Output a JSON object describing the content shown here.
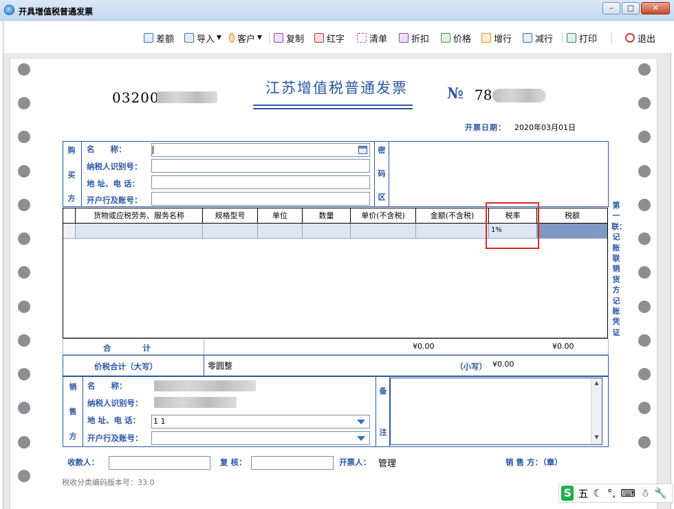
{
  "window": {
    "title": "开具增值税普通发票",
    "controls": [
      "–",
      "□",
      "✕"
    ]
  },
  "toolbar": {
    "items": [
      {
        "name": "quota",
        "label": "差额",
        "icon": "list-icon",
        "color": "#3a6fb0"
      },
      {
        "name": "import",
        "label": "导入",
        "icon": "import-icon",
        "color": "#3a6fb0",
        "caret": "▼"
      },
      {
        "name": "customer",
        "label": "客户",
        "icon": "customer-icon",
        "color": "#d08a1e",
        "caret": "▼"
      },
      {
        "name": "copy",
        "label": "复制",
        "icon": "copy-icon",
        "color": "#8a4aa8"
      },
      {
        "name": "red",
        "label": "红字",
        "icon": "red-invoice-icon",
        "color": "#c33333"
      },
      {
        "name": "list",
        "label": "清单",
        "icon": "bullet-list-icon",
        "color": "#c33399"
      },
      {
        "name": "discount",
        "label": "折扣",
        "icon": "discount-icon",
        "color": "#8a4aa8"
      },
      {
        "name": "price",
        "label": "价格",
        "icon": "price-icon",
        "color": "#3c9a3c"
      },
      {
        "name": "add-row",
        "label": "增行",
        "icon": "add-row-icon",
        "color": "#d08a1e"
      },
      {
        "name": "del-row",
        "label": "减行",
        "icon": "delete-row-icon",
        "color": "#3a6fb0"
      },
      {
        "name": "print",
        "label": "打印",
        "icon": "printer-icon",
        "color": "#2e8b57"
      },
      {
        "name": "exit",
        "label": "退出",
        "icon": "power-icon",
        "color": "#d23b3b"
      }
    ]
  },
  "invoice": {
    "code_prefix": "03200",
    "title": "江苏增值税普通发票",
    "number_mark": "№",
    "number_prefix": "78",
    "date_label": "开票日期：",
    "date": "2020年03月01日"
  },
  "buyer": {
    "section": [
      "购",
      "买",
      "方"
    ],
    "name_label": "名　　称：",
    "tax_id_label": "纳税人识别号：",
    "address_label": "地 址、电 话：",
    "bank_label": "开户行及账号：",
    "name": "",
    "tax_id": "",
    "address": "",
    "bank": ""
  },
  "cipher": {
    "section": [
      "密",
      "码",
      "区"
    ]
  },
  "goods": {
    "headers": [
      "货物或应税劳务、服务名称",
      "规格型号",
      "单位",
      "数量",
      "单价(不含税)",
      "金额(不含税)",
      "税率",
      "税额"
    ],
    "rows": [
      {
        "name": "",
        "spec": "",
        "unit": "",
        "qty": "",
        "price": "",
        "amount": "",
        "rate": "1%",
        "tax": ""
      }
    ]
  },
  "sidebar_note": "第一联：记账联　销货方记账凭证",
  "totals": {
    "label": "合　　　　计",
    "amount": "¥0.00",
    "tax": "¥0.00",
    "total_label": "价税合计（大写）",
    "total_words": "零圆整",
    "small_label": "（小写）",
    "total_small": "¥0.00"
  },
  "seller": {
    "section": [
      "销",
      "售",
      "方"
    ],
    "name_label": "名　　称：",
    "tax_id_label": "纳税人识别号：",
    "address_label": "地 址、电 话：",
    "bank_label": "开户行及账号：",
    "address": "1 1",
    "bank": ""
  },
  "remark": {
    "section": [
      "备",
      "注"
    ]
  },
  "footer": {
    "payee_label": "收款人：",
    "reviewer_label": "复 核：",
    "issuer_label": "开票人：",
    "issuer": "管理",
    "seller_label": "销 售 方：（章）",
    "version": "税收分类编码版本号：33.0"
  },
  "ime": {
    "logo": "S",
    "mode": "五",
    "icons": [
      "☾",
      "°,",
      "⌨",
      "☃",
      "🔧"
    ]
  }
}
